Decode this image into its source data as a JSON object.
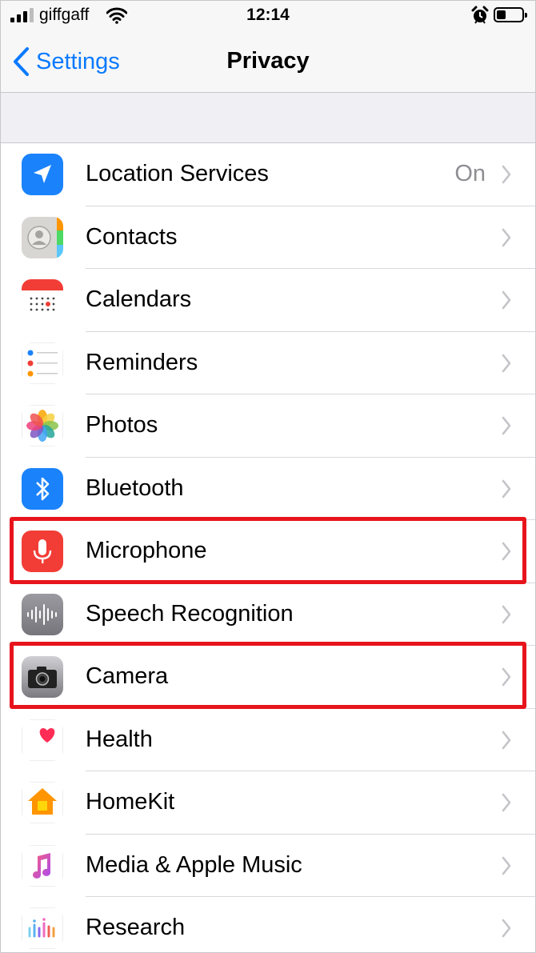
{
  "status_bar": {
    "carrier": "giffgaff",
    "time": "12:14",
    "battery_level": 0.35
  },
  "nav": {
    "back_label": "Settings",
    "title": "Privacy"
  },
  "items": [
    {
      "label": "Location Services",
      "value": "On",
      "icon": "location-arrow-icon",
      "color": "#1a82fb"
    },
    {
      "label": "Contacts",
      "value": "",
      "icon": "contacts-icon",
      "color": "#d6d6d6"
    },
    {
      "label": "Calendars",
      "value": "",
      "icon": "calendar-icon",
      "color": "#ff3b30"
    },
    {
      "label": "Reminders",
      "value": "",
      "icon": "reminders-icon",
      "color": "#ffffff"
    },
    {
      "label": "Photos",
      "value": "",
      "icon": "photos-icon",
      "color": "#ffffff"
    },
    {
      "label": "Bluetooth",
      "value": "",
      "icon": "bluetooth-icon",
      "color": "#1a82fb"
    },
    {
      "label": "Microphone",
      "value": "",
      "icon": "microphone-icon",
      "color": "#f23d36"
    },
    {
      "label": "Speech Recognition",
      "value": "",
      "icon": "waveform-icon",
      "color": "#8e8e93"
    },
    {
      "label": "Camera",
      "value": "",
      "icon": "camera-icon",
      "color": "#8a8a8f"
    },
    {
      "label": "Health",
      "value": "",
      "icon": "heart-icon",
      "color": "#ff2d55"
    },
    {
      "label": "HomeKit",
      "value": "",
      "icon": "home-icon",
      "color": "#ff9500"
    },
    {
      "label": "Media & Apple Music",
      "value": "",
      "icon": "music-note-icon",
      "color": "#fc3c74"
    },
    {
      "label": "Research",
      "value": "",
      "icon": "research-icon",
      "color": "#2f8bf5"
    }
  ],
  "highlight_color": "#e8141c"
}
